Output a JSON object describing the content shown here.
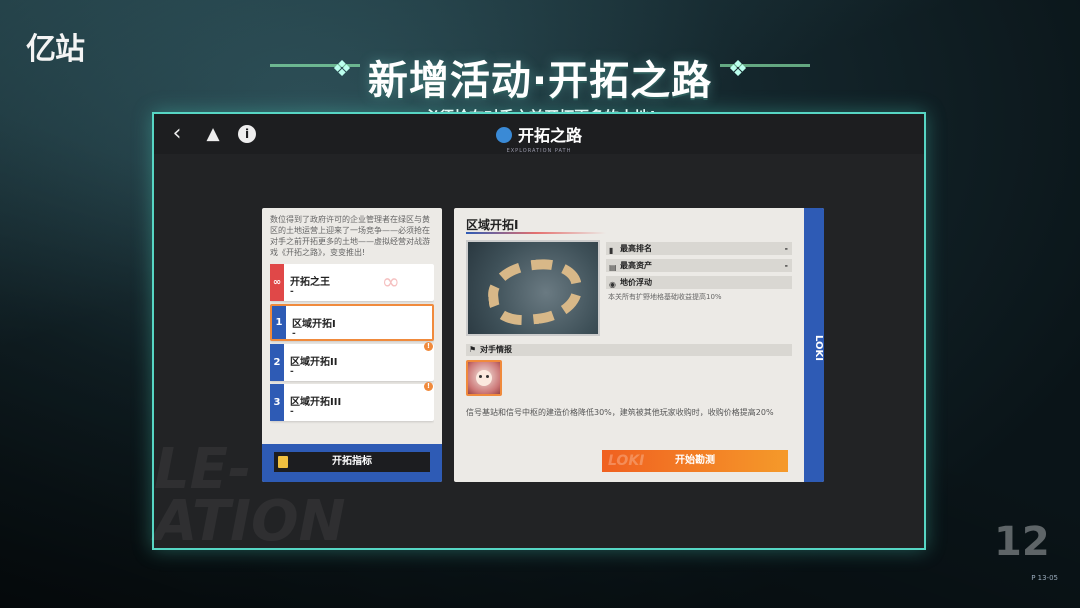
{
  "brand": {
    "logo_text": "亿站",
    "logo_small": ""
  },
  "headline": {
    "title": "新增活动·开拓之路",
    "subtitle": "必须抢在对手之前开拓更多的土地!"
  },
  "window": {
    "title": "开拓之路",
    "title_code": "EXPLORATION PATH",
    "back_icon": "back-chevron",
    "drive_icon": "triangle-drive",
    "info_icon": "info"
  },
  "left_panel": {
    "intro": "数位得到了政府许可的企业管理者在绿区与黄区的土地运营上迎来了一场竞争——必须抢在对手之前开拓更多的土地——虚拟经营对战游戏《开拓之路》，变变推出!",
    "levels": [
      {
        "num": "∞",
        "name": "开拓之王",
        "value": "-",
        "color": "#e04848",
        "selected": false,
        "alert": false
      },
      {
        "num": "1",
        "name": "区域开拓I",
        "value": "-",
        "color": "#2e5bb5",
        "selected": true,
        "alert": false
      },
      {
        "num": "2",
        "name": "区域开拓II",
        "value": "-",
        "color": "#2e5bb5",
        "selected": false,
        "alert": true
      },
      {
        "num": "3",
        "name": "区域开拓III",
        "value": "-",
        "color": "#2e5bb5",
        "selected": false,
        "alert": true
      }
    ],
    "metric_button": "开拓指标"
  },
  "right_panel": {
    "title": "区域开拓I",
    "stats": [
      {
        "icon": "chart-icon",
        "label": "最高排名",
        "value": "-"
      },
      {
        "icon": "assets-icon",
        "label": "最高资产",
        "value": "-"
      },
      {
        "icon": "price-icon",
        "label": "地价浮动",
        "value": ""
      }
    ],
    "price_desc": "本关所有扩野地格基础收益提高10%",
    "intel_label": "对手情报",
    "intel_desc": "信号基站和信号中枢的建造价格降低30%，建筑被其他玩家收购时，收购价格提高20%",
    "start_button": "开始勘测",
    "strip_text": "LOKI"
  },
  "corner": {
    "badge": "12",
    "code": "P 13-05"
  }
}
